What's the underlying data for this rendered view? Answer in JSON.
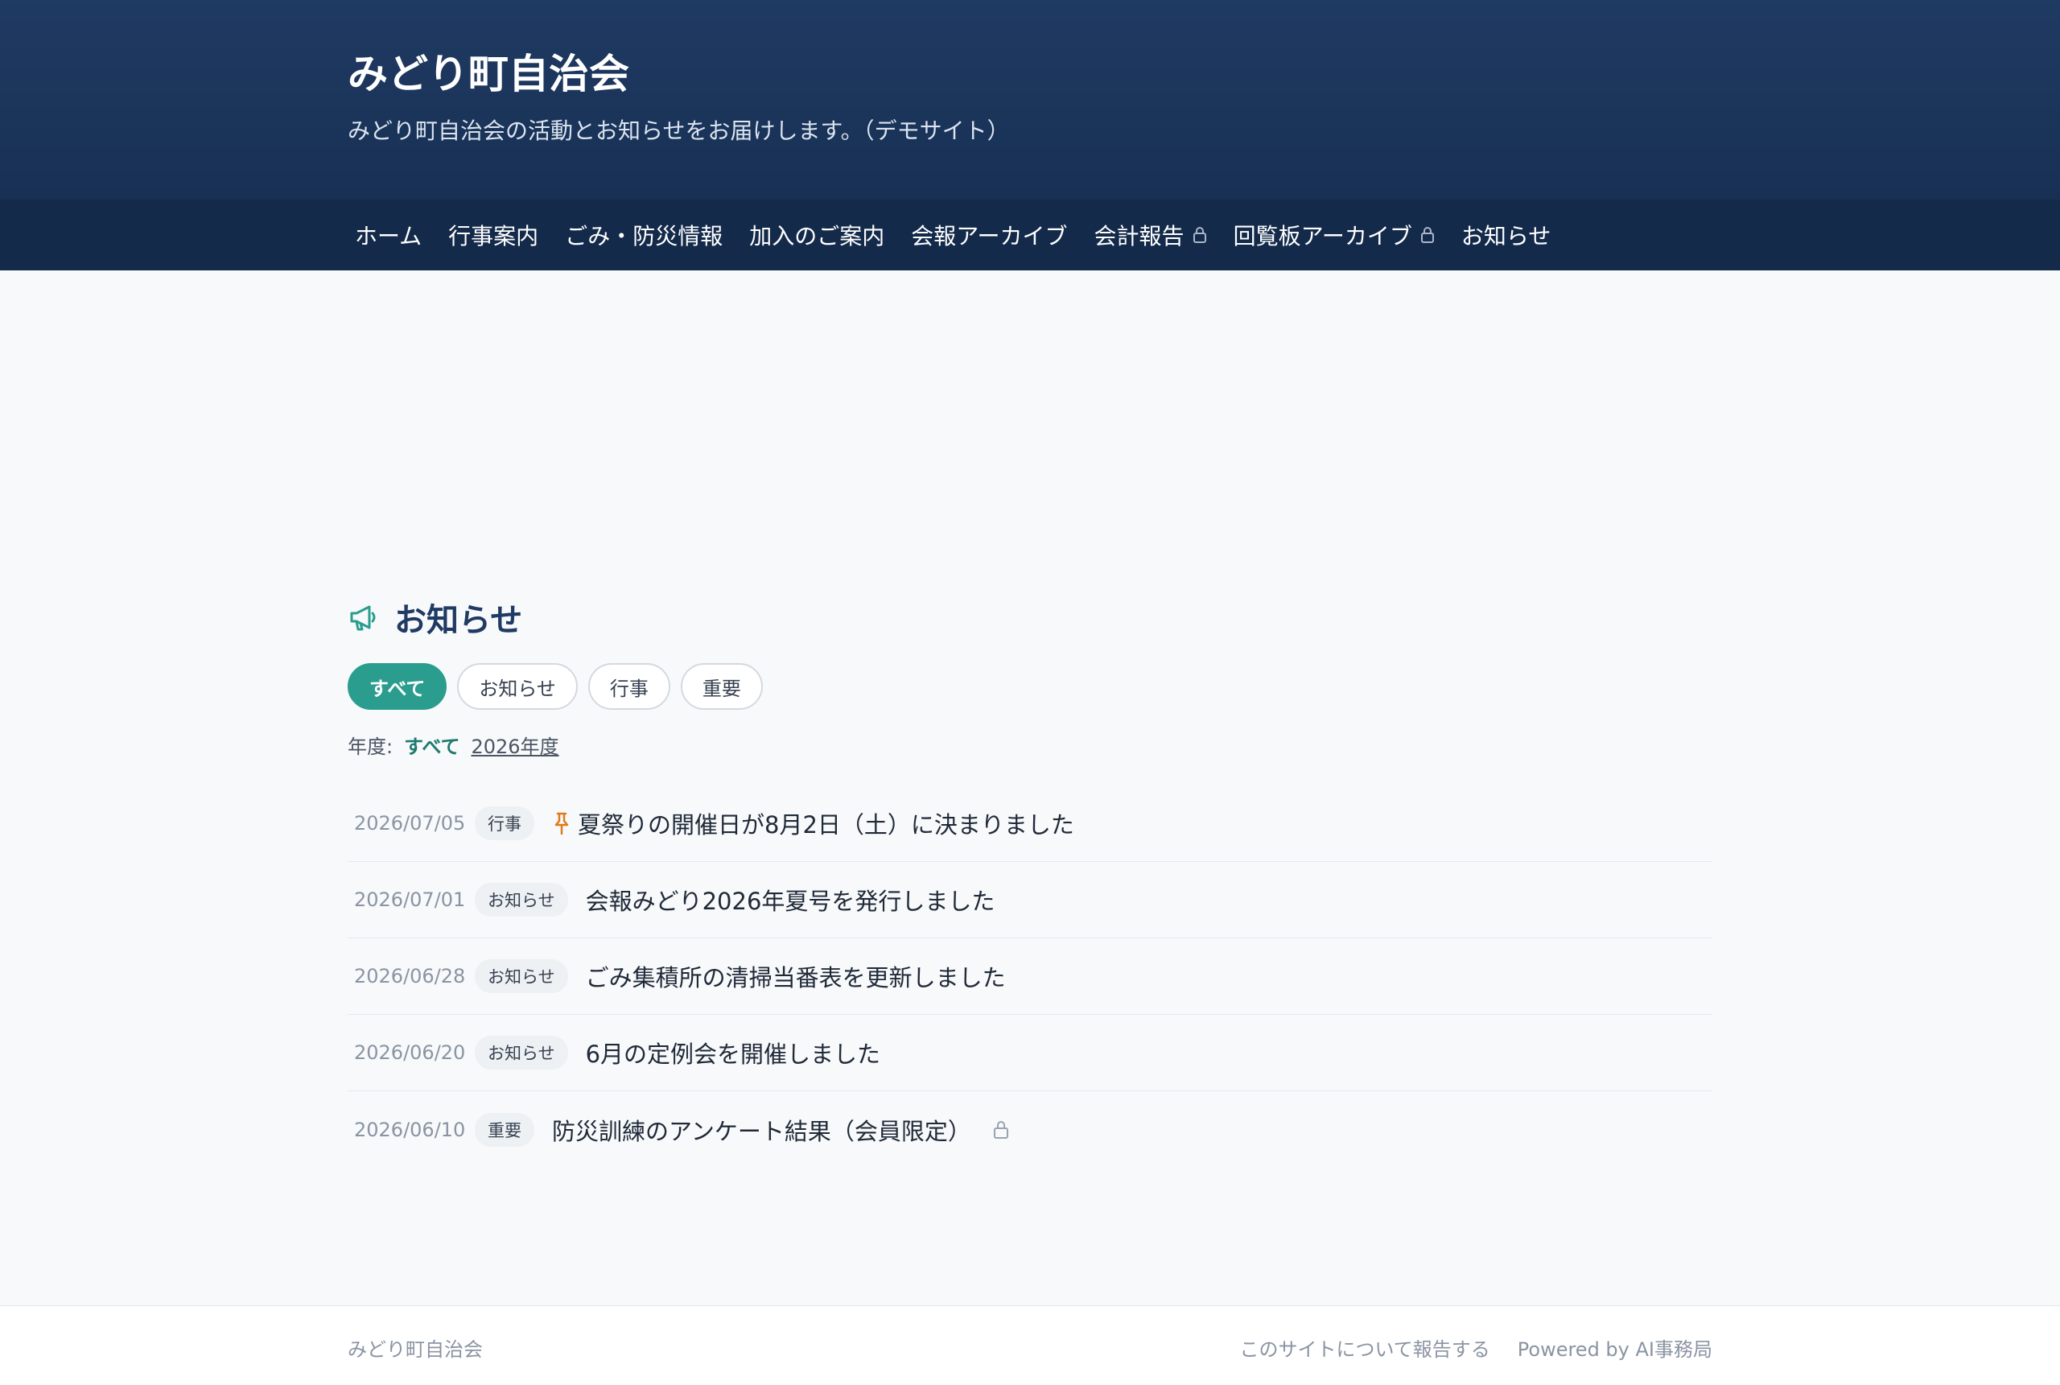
{
  "header": {
    "site_title": "みどり町自治会",
    "site_description": "みどり町自治会の活動とお知らせをお届けします。（デモサイト）"
  },
  "nav": {
    "items": [
      {
        "label": "ホーム",
        "locked": false
      },
      {
        "label": "行事案内",
        "locked": false
      },
      {
        "label": "ごみ・防災情報",
        "locked": false
      },
      {
        "label": "加入のご案内",
        "locked": false
      },
      {
        "label": "会報アーカイブ",
        "locked": false
      },
      {
        "label": "会計報告",
        "locked": true
      },
      {
        "label": "回覧板アーカイブ",
        "locked": true
      },
      {
        "label": "お知らせ",
        "locked": false
      }
    ]
  },
  "page": {
    "heading": "お知らせ",
    "heading_icon": "megaphone-icon"
  },
  "filters": {
    "categories": [
      {
        "label": "すべて",
        "active": true
      },
      {
        "label": "お知らせ",
        "active": false
      },
      {
        "label": "行事",
        "active": false
      },
      {
        "label": "重要",
        "active": false
      }
    ],
    "year_label": "年度:",
    "years": [
      {
        "label": "すべて",
        "active": true
      },
      {
        "label": "2026年度",
        "active": false
      }
    ]
  },
  "news": [
    {
      "date": "2026/07/05",
      "tag": "行事",
      "title": "夏祭りの開催日が8月2日（土）に決まりました",
      "pinned": true,
      "locked": false
    },
    {
      "date": "2026/07/01",
      "tag": "お知らせ",
      "title": "会報みどり2026年夏号を発行しました",
      "pinned": false,
      "locked": false
    },
    {
      "date": "2026/06/28",
      "tag": "お知らせ",
      "title": "ごみ集積所の清掃当番表を更新しました",
      "pinned": false,
      "locked": false
    },
    {
      "date": "2026/06/20",
      "tag": "お知らせ",
      "title": "6月の定例会を開催しました",
      "pinned": false,
      "locked": false
    },
    {
      "date": "2026/06/10",
      "tag": "重要",
      "title": "防災訓練のアンケート結果（会員限定）",
      "pinned": false,
      "locked": true
    }
  ],
  "footer": {
    "left": "みどり町自治会",
    "report_link": "このサイトについて報告する",
    "powered_by": "Powered by AI事務局"
  },
  "colors": {
    "header_bg": "#1f3a63",
    "nav_bg": "#142a4a",
    "accent": "#2a9d8f",
    "pin": "#e07b1a"
  }
}
